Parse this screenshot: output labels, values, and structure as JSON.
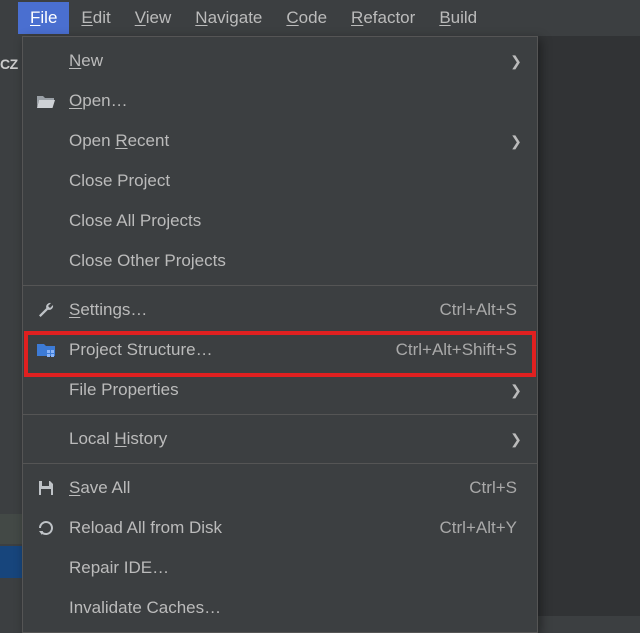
{
  "left_label": "CZ",
  "menubar": [
    {
      "label": "File",
      "mn": "F",
      "active": true
    },
    {
      "label": "Edit",
      "mn": "E"
    },
    {
      "label": "View",
      "mn": "V"
    },
    {
      "label": "Navigate",
      "mn": "N"
    },
    {
      "label": "Code",
      "mn": "C"
    },
    {
      "label": "Refactor",
      "mn": "R"
    },
    {
      "label": "Build",
      "mn": "B"
    }
  ],
  "menu": {
    "new": {
      "label": "New",
      "mn": "N",
      "submenu": true
    },
    "open": {
      "label": "Open…",
      "mn": "O"
    },
    "open_recent": {
      "label": "Open Recent",
      "mn": "R",
      "submenu": true
    },
    "close_project": {
      "label": "Close Project"
    },
    "close_all": {
      "label": "Close All Projects"
    },
    "close_other": {
      "label": "Close Other Projects"
    },
    "settings": {
      "label": "Settings…",
      "mn": "S",
      "shortcut": "Ctrl+Alt+S"
    },
    "project_struct": {
      "label": "Project Structure…",
      "shortcut": "Ctrl+Alt+Shift+S"
    },
    "file_props": {
      "label": "File Properties",
      "submenu": true
    },
    "local_history": {
      "label": "Local History",
      "mn": "H",
      "submenu": true
    },
    "save_all": {
      "label": "Save All",
      "mn": "S",
      "shortcut": "Ctrl+S"
    },
    "reload_disk": {
      "label": "Reload All from Disk",
      "shortcut": "Ctrl+Alt+Y"
    },
    "repair_ide": {
      "label": "Repair IDE…"
    },
    "invalidate": {
      "label": "Invalidate Caches…"
    }
  }
}
